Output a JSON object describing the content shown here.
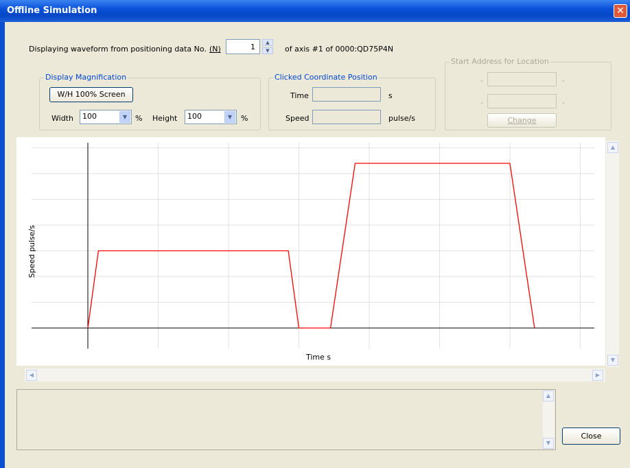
{
  "window": {
    "title": "Offline Simulation",
    "close_glyph": "✕"
  },
  "display_row": {
    "prefix": "Displaying waveform from positioning data No.",
    "shortcut": "(N)",
    "data_no": "1",
    "suffix": "of axis #1 of 0000:QD75P4N"
  },
  "magnification": {
    "group_title": "Display Magnification",
    "button_label": "W/H 100% Screen",
    "width_label": "Width",
    "width_value": "100",
    "height_label": "Height",
    "height_value": "100",
    "percent": "%"
  },
  "coordinate": {
    "group_title": "Clicked Coordinate Position",
    "time_label": "Time",
    "time_value": "",
    "time_unit": "s",
    "speed_label": "Speed",
    "speed_value": "",
    "speed_unit": "pulse/s"
  },
  "start_address": {
    "group_title": "Start Address for Location",
    "dash": "-",
    "change_label": "Change"
  },
  "chart_data": {
    "type": "line",
    "xlabel": "Time s",
    "ylabel": "Speed pulse/s",
    "grid": true,
    "series": [
      {
        "color": "#ff0000",
        "x": [
          0.0,
          0.15,
          2.85,
          3.0,
          3.45,
          3.8,
          6.0,
          6.35
        ],
        "y": [
          0,
          3,
          3,
          0,
          0,
          6.4,
          6.4,
          0
        ]
      }
    ],
    "xlim": [
      -0.8,
      7.2
    ],
    "ylim": [
      -0.8,
      7.2
    ]
  },
  "footer": {
    "close_label": "Close",
    "message": ""
  },
  "colors": {
    "waveform": "#ff0000",
    "title_bar": "#0a52d8"
  }
}
